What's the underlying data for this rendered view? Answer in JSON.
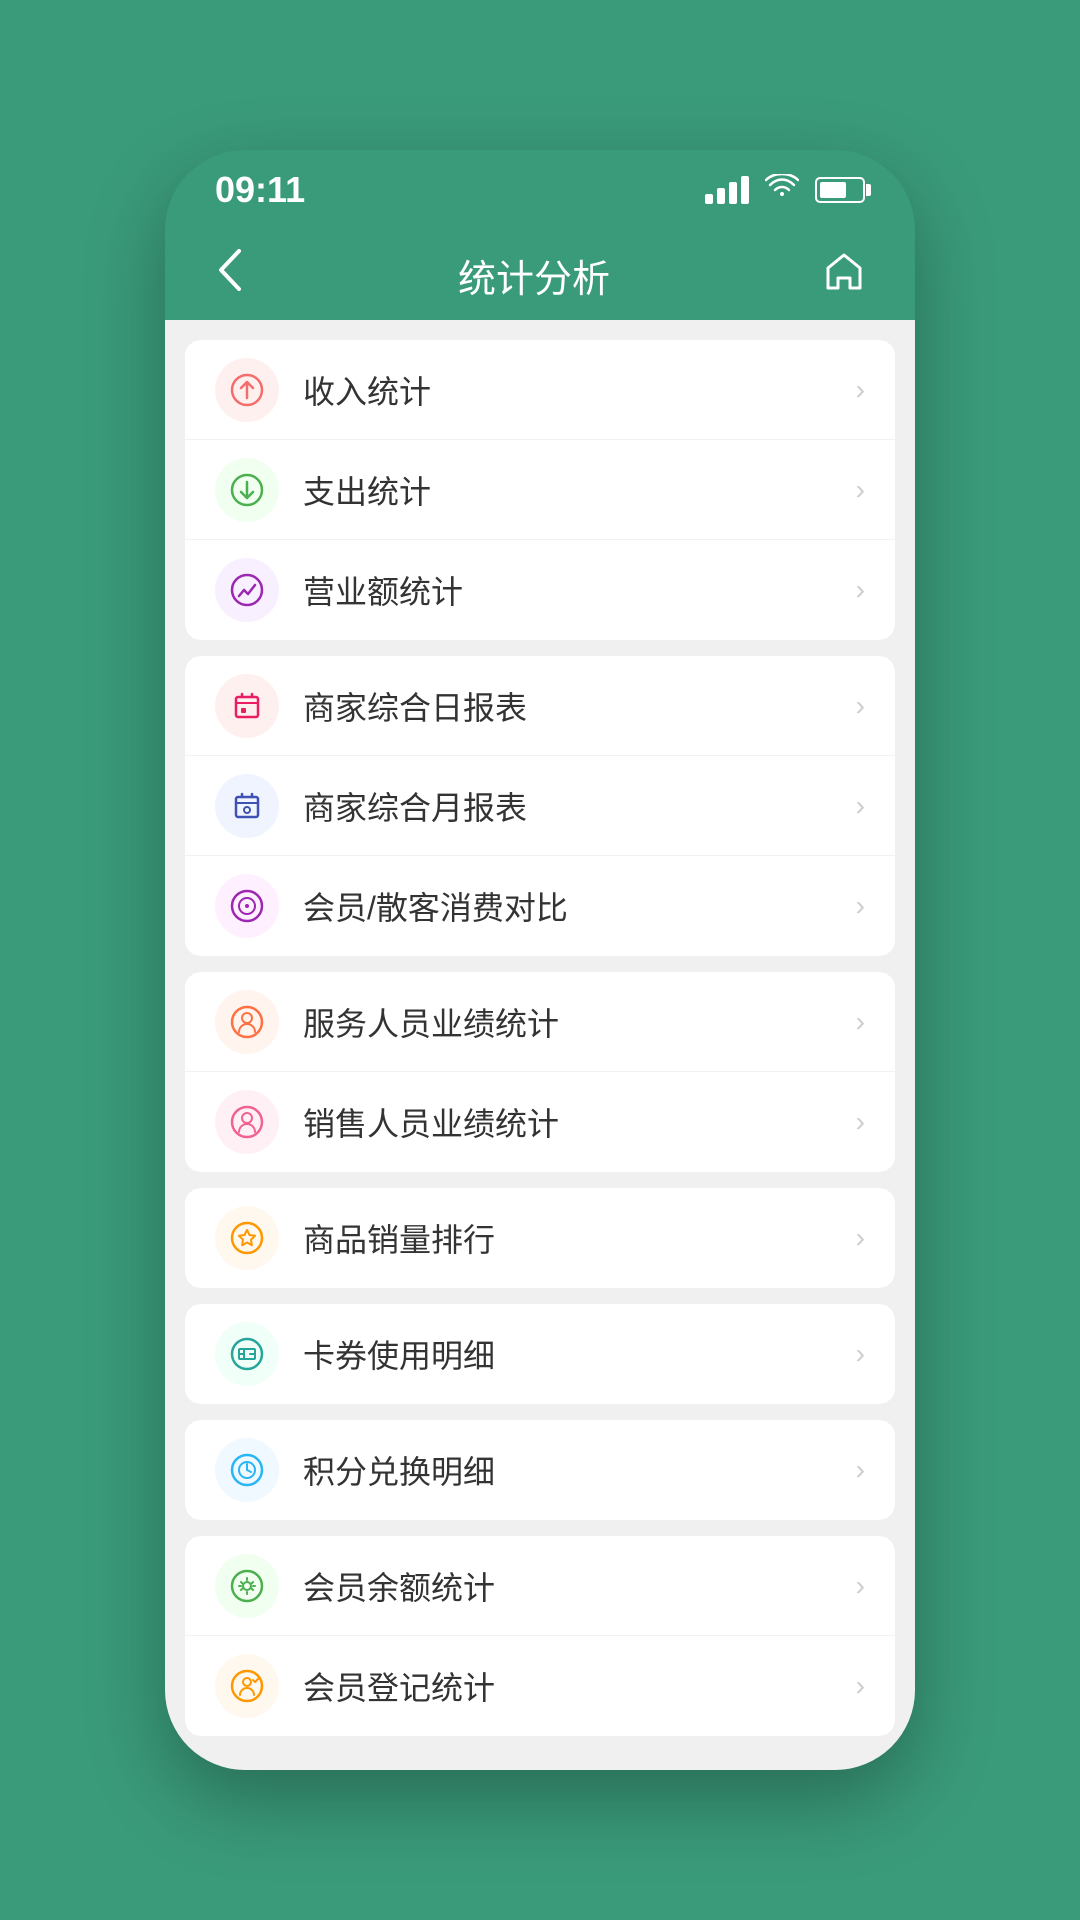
{
  "statusBar": {
    "time": "09:11"
  },
  "navBar": {
    "title": "统计分析",
    "backLabel": "‹",
    "homeLabel": "⌂"
  },
  "groups": [
    {
      "id": "group1",
      "items": [
        {
          "id": "income",
          "label": "收入统计",
          "iconClass": "icon-income",
          "iconSymbol": "⊕"
        },
        {
          "id": "expense",
          "label": "支出统计",
          "iconClass": "icon-expense",
          "iconSymbol": "⊖"
        },
        {
          "id": "revenue",
          "label": "营业额统计",
          "iconClass": "icon-revenue",
          "iconSymbol": "📈"
        }
      ]
    },
    {
      "id": "group2",
      "items": [
        {
          "id": "daily",
          "label": "商家综合日报表",
          "iconClass": "icon-daily",
          "iconSymbol": "📋"
        },
        {
          "id": "monthly",
          "label": "商家综合月报表",
          "iconClass": "icon-monthly",
          "iconSymbol": "📅"
        },
        {
          "id": "member-compare",
          "label": "会员/散客消费对比",
          "iconClass": "icon-member-compare",
          "iconSymbol": "◎"
        }
      ]
    },
    {
      "id": "group3",
      "items": [
        {
          "id": "service-perf",
          "label": "服务人员业绩统计",
          "iconClass": "icon-service",
          "iconSymbol": "👤"
        },
        {
          "id": "sales-perf",
          "label": "销售人员业绩统计",
          "iconClass": "icon-sales",
          "iconSymbol": "👤"
        }
      ]
    },
    {
      "id": "group4",
      "items": [
        {
          "id": "product-rank",
          "label": "商品销量排行",
          "iconClass": "icon-product",
          "iconSymbol": "🏆"
        }
      ]
    },
    {
      "id": "group5",
      "items": [
        {
          "id": "coupon",
          "label": "卡券使用明细",
          "iconClass": "icon-coupon",
          "iconSymbol": "🎫"
        }
      ]
    },
    {
      "id": "group6",
      "items": [
        {
          "id": "points",
          "label": "积分兑换明细",
          "iconClass": "icon-points",
          "iconSymbol": "◉"
        }
      ]
    },
    {
      "id": "group7",
      "items": [
        {
          "id": "balance",
          "label": "会员余额统计",
          "iconClass": "icon-balance",
          "iconSymbol": "💰"
        },
        {
          "id": "register",
          "label": "会员登记统计",
          "iconClass": "icon-register",
          "iconSymbol": "👤"
        }
      ]
    }
  ],
  "chevron": "›"
}
